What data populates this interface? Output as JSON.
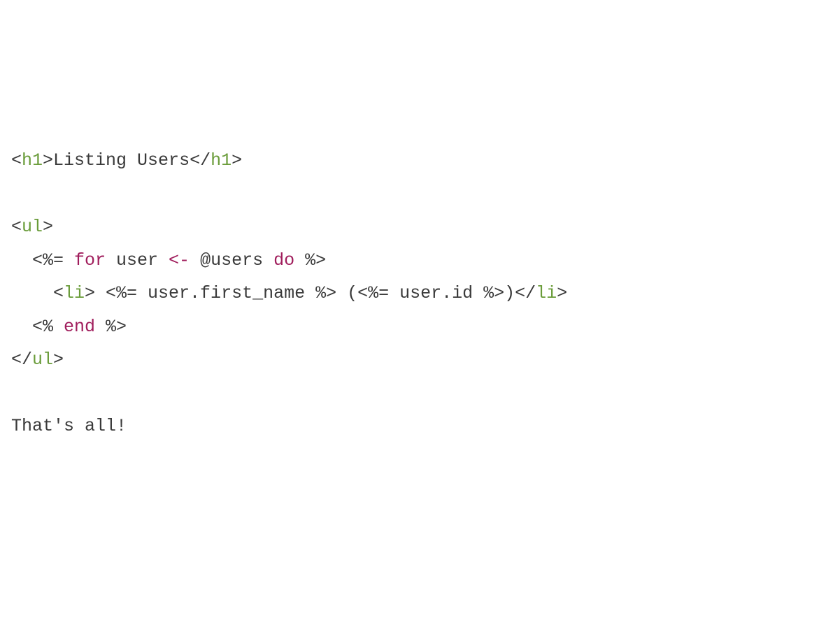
{
  "lines": {
    "l1": {
      "t1": "<",
      "t2": "h1",
      "t3": ">Listing Users</",
      "t4": "h1",
      "t5": ">"
    },
    "l2": "",
    "l3": {
      "t1": "<",
      "t2": "ul",
      "t3": ">"
    },
    "l4": {
      "t1": "  <%= ",
      "t2": "for",
      "t3": " user ",
      "t4": "<-",
      "t5": " @users ",
      "t6": "do",
      "t7": " %>"
    },
    "l5": {
      "t1": "    <",
      "t2": "li",
      "t3": "> <%= user.first_name %> (<%= user.id %>)</",
      "t4": "li",
      "t5": ">"
    },
    "l6": {
      "t1": "  <% ",
      "t2": "end",
      "t3": " %>"
    },
    "l7": {
      "t1": "</",
      "t2": "ul",
      "t3": ">"
    },
    "l8": "",
    "l9": "That's all!"
  }
}
